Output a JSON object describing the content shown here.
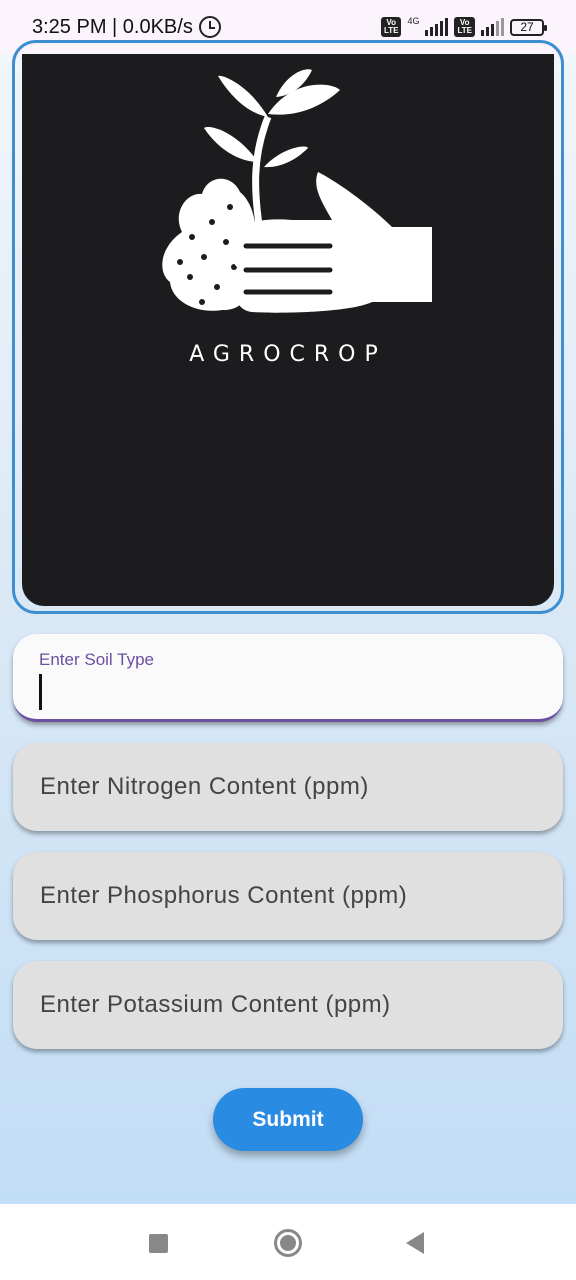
{
  "status_bar": {
    "time": "3:25 PM | 0.0KB/s",
    "volte_1": "Vo\nLTE",
    "network": "4G",
    "volte_2": "Vo\nLTE",
    "battery": "27",
    "icons": [
      "alarm-icon",
      "volte-icon",
      "signal-icon",
      "volte-icon",
      "signal-icon",
      "battery-icon"
    ]
  },
  "logo": {
    "brand": "AGROCROP",
    "icon": "hand-with-seedling-logo"
  },
  "form": {
    "soil": {
      "label": "Enter Soil Type",
      "value": ""
    },
    "nitrogen": {
      "placeholder": "Enter Nitrogen Content (ppm)"
    },
    "phosphorus": {
      "placeholder": "Enter Phosphorus Content (ppm)"
    },
    "potassium": {
      "placeholder": "Enter Potassium Content (ppm)"
    },
    "submit_label": "Submit"
  },
  "colors": {
    "accent": "#2a8be3",
    "focus": "#6b4fa3",
    "card": "#1c1c1e"
  },
  "nav": {
    "icons": [
      "recent-apps-icon",
      "home-icon",
      "back-icon"
    ]
  }
}
